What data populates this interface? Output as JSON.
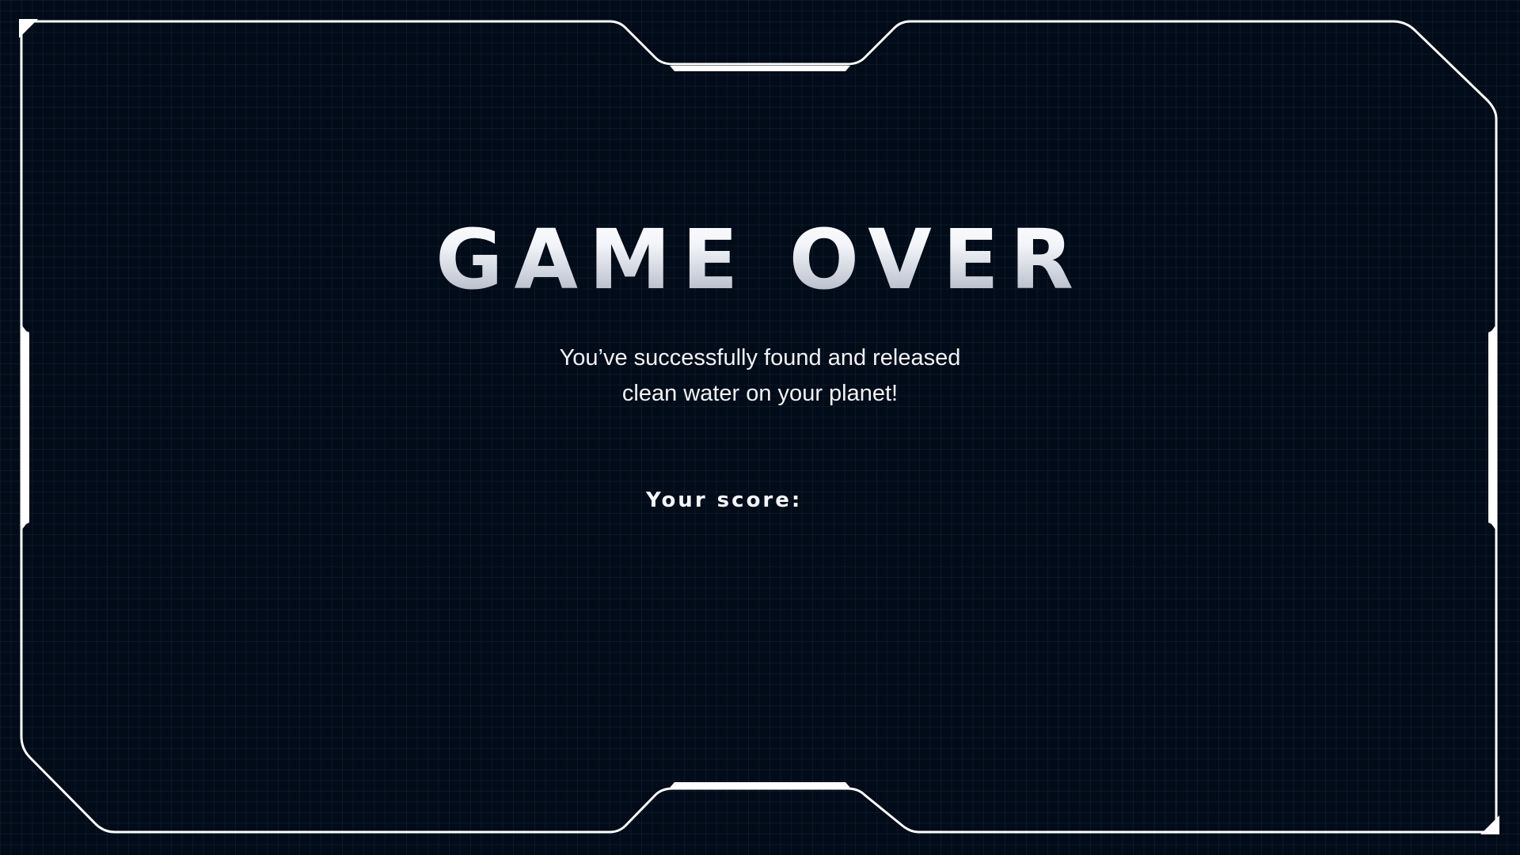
{
  "game": {
    "title": "GAME OVER",
    "message_line1": "You’ve successfully found and released",
    "message_line2": "clean water on your planet!",
    "score_label": "Your score:"
  },
  "colors": {
    "background": "#020b18",
    "grid": "#1d3047",
    "frame": "#ffffff",
    "text": "#f1f3f7"
  }
}
